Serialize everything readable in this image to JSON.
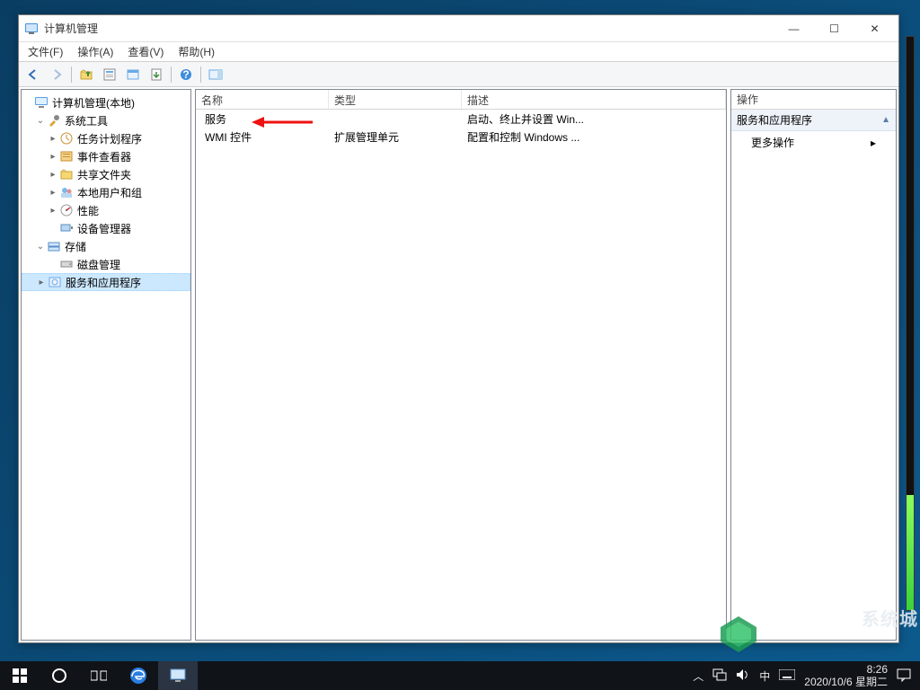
{
  "window": {
    "title": "计算机管理",
    "controls": {
      "minimize": "—",
      "maximize": "☐",
      "close": "✕"
    }
  },
  "menu": {
    "file": "文件(F)",
    "action": "操作(A)",
    "view": "查看(V)",
    "help": "帮助(H)"
  },
  "toolbar": {
    "back": "后退",
    "forward": "前进",
    "up": "上移",
    "properties": "属性",
    "refresh": "刷新",
    "export": "导出列表",
    "help": "帮助",
    "show_hide": "显示/隐藏操作窗格"
  },
  "tree": {
    "root": "计算机管理(本地)",
    "system_tools": "系统工具",
    "task_scheduler": "任务计划程序",
    "event_viewer": "事件查看器",
    "shared_folders": "共享文件夹",
    "local_users": "本地用户和组",
    "performance": "性能",
    "device_manager": "设备管理器",
    "storage": "存储",
    "disk_management": "磁盘管理",
    "services_apps": "服务和应用程序"
  },
  "list": {
    "columns": {
      "name": "名称",
      "type": "类型",
      "desc": "描述"
    },
    "rows": [
      {
        "name": "服务",
        "type": "",
        "desc": "启动、终止并设置 Win..."
      },
      {
        "name": "WMI 控件",
        "type": "扩展管理单元",
        "desc": "配置和控制 Windows ..."
      }
    ]
  },
  "actions": {
    "header": "操作",
    "section": "服务和应用程序",
    "more": "更多操作"
  },
  "taskbar": {
    "time": "8:26",
    "date": "2020/10/6 星期二",
    "ime": "中"
  },
  "watermark": "系统城"
}
